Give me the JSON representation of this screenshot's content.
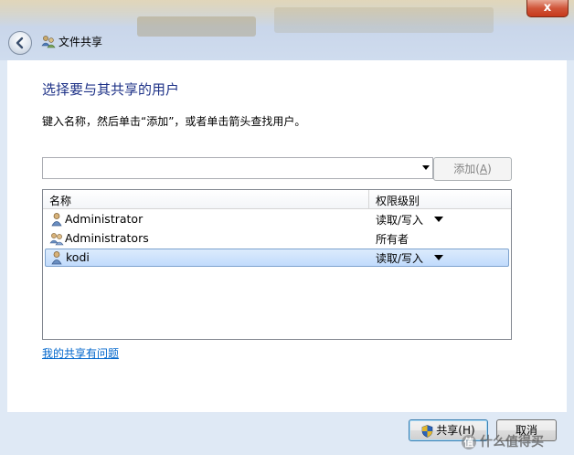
{
  "window": {
    "title": "文件共享",
    "close_label": "x"
  },
  "dialog": {
    "heading": "选择要与其共享的用户",
    "instruction": "键入名称，然后单击“添加”，或者单击箭头查找用户。",
    "name_input": {
      "value": "",
      "placeholder": ""
    },
    "add_button": {
      "label": "添加(",
      "accel": "A",
      "suffix": ")",
      "enabled": false
    }
  },
  "list": {
    "columns": {
      "name": "名称",
      "permission": "权限级别"
    },
    "rows": [
      {
        "name": "Administrator",
        "permission": "读取/写入",
        "has_dropdown": true,
        "selected": false,
        "icon": "user-icon"
      },
      {
        "name": "Administrators",
        "permission": "所有者",
        "has_dropdown": false,
        "selected": false,
        "icon": "group-icon"
      },
      {
        "name": "kodi",
        "permission": "读取/写入",
        "has_dropdown": true,
        "selected": true,
        "icon": "user-icon"
      }
    ]
  },
  "help_link": "我的共享有问题",
  "footer": {
    "share_label": "共享(H)",
    "cancel_label": "取消"
  },
  "watermark": {
    "text": "什么值得买"
  },
  "colors": {
    "heading": "#1e3287",
    "link": "#0066cc",
    "close_red": "#c7391b",
    "selection": "#c1dbfc"
  }
}
